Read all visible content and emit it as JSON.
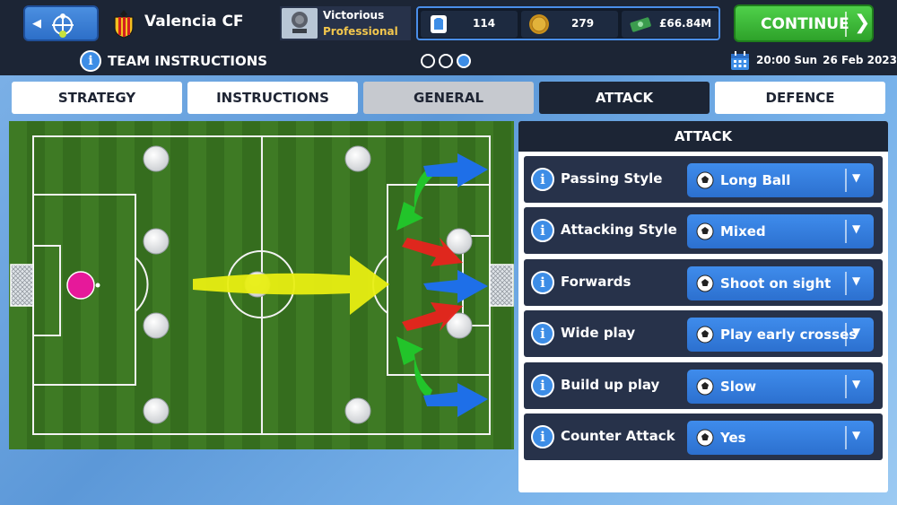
{
  "header": {
    "club_name": "Valencia CF",
    "manager_reputation": "Victorious",
    "manager_level": "Professional",
    "resources": [
      {
        "icon": "shirt-token-icon",
        "value": "114"
      },
      {
        "icon": "gold-coin-icon",
        "value": "279"
      },
      {
        "icon": "cash-icon",
        "value": "£66.84M"
      }
    ],
    "continue_label": "CONTINUE"
  },
  "subheader": {
    "title": "TEAM INSTRUCTIONS",
    "time": "20:00 Sun",
    "date": "26 Feb 2023",
    "page_dots": 3,
    "active_dot": 3
  },
  "tabs": [
    {
      "label": "STRATEGY",
      "state": "normal"
    },
    {
      "label": "INSTRUCTIONS",
      "state": "normal"
    },
    {
      "label": "GENERAL",
      "state": "inactive"
    },
    {
      "label": "ATTACK",
      "state": "selected"
    },
    {
      "label": "DEFENCE",
      "state": "normal"
    }
  ],
  "panel": {
    "title": "ATTACK",
    "rows": [
      {
        "label": "Passing Style",
        "value": "Long Ball"
      },
      {
        "label": "Attacking Style",
        "value": "Mixed"
      },
      {
        "label": "Forwards",
        "value": "Shoot on sight"
      },
      {
        "label": "Wide play",
        "value": "Play early crosses"
      },
      {
        "label": "Build up play",
        "value": "Slow"
      },
      {
        "label": "Counter Attack",
        "value": "Yes"
      }
    ]
  },
  "colors": {
    "accent_blue": "#3d8de6",
    "continue_green": "#3cbd37",
    "dark_navy": "#1c2535",
    "goalkeeper": "#e6199a"
  }
}
